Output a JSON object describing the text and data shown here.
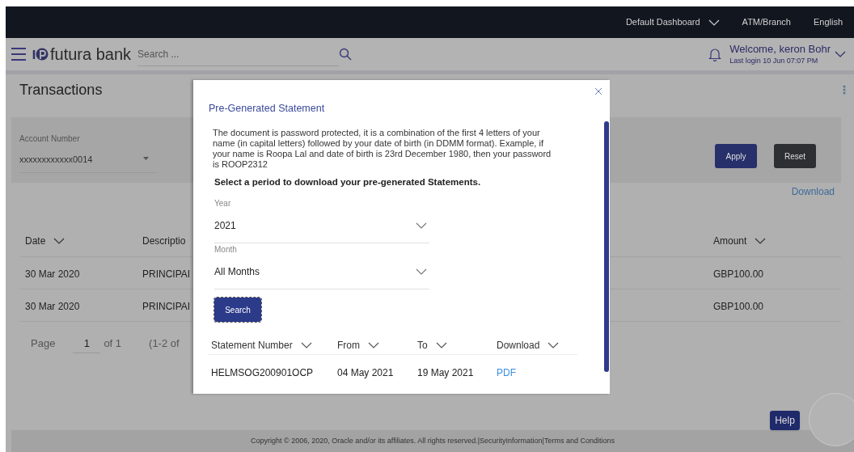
{
  "top_bar": {
    "items": [
      {
        "label": "Default Dashboard",
        "dropdown": true
      },
      {
        "label": "ATM/Branch",
        "dropdown": false
      },
      {
        "label": "English",
        "dropdown": false
      }
    ]
  },
  "header": {
    "brand": "futura bank",
    "search_placeholder": "Search ...",
    "welcome": "Welcome, keron Bohr",
    "last_login": "Last login 10 Jun 07:07 PM"
  },
  "page": {
    "title": "Transactions"
  },
  "filter": {
    "account_label": "Account Number",
    "account_value": "xxxxxxxxxxxx0014",
    "buttons": [
      {
        "label": "Apply",
        "kind": "primary"
      },
      {
        "label": "Reset",
        "kind": "secondary"
      }
    ]
  },
  "download_link": "Download",
  "table": {
    "columns": [
      "Date",
      "Descriptio",
      "Amount"
    ],
    "rows": [
      [
        "30 Mar 2020",
        "PRINCIPAI",
        "GBP100.00"
      ],
      [
        "30 Mar 2020",
        "PRINCIPAI",
        "GBP100.00"
      ]
    ]
  },
  "pagination": {
    "label": "Page",
    "page": "1",
    "of": "of 1",
    "range": "(1-2 of"
  },
  "help": "Help",
  "footer": "Copyright © 2006, 2020, Oracle and/or its affiliates. All rights reserved.|SecurityInformation|Terms and Conditions",
  "modal": {
    "title": "Pre-Generated Statement",
    "note": "The document is password protected, it is a combination of the first 4 letters of your name (in capital letters) followed by your date of birth (in DDMM format). Example, if your name is Roopa Lal and date of birth is 23rd December 1980, then your password is ROOP2312",
    "instruction": "Select a period to download your pre-generated Statements.",
    "fields": [
      {
        "label": "Year",
        "value": "2021"
      },
      {
        "label": "Month",
        "value": "All Months"
      }
    ],
    "search_button": "Search",
    "columns": [
      "Statement Number",
      "From",
      "To",
      "Download"
    ],
    "rows": [
      {
        "number": "HELMSOG200901OCP",
        "from": "04 May 2021",
        "to": "19 May 2021",
        "link": "PDF"
      }
    ]
  }
}
